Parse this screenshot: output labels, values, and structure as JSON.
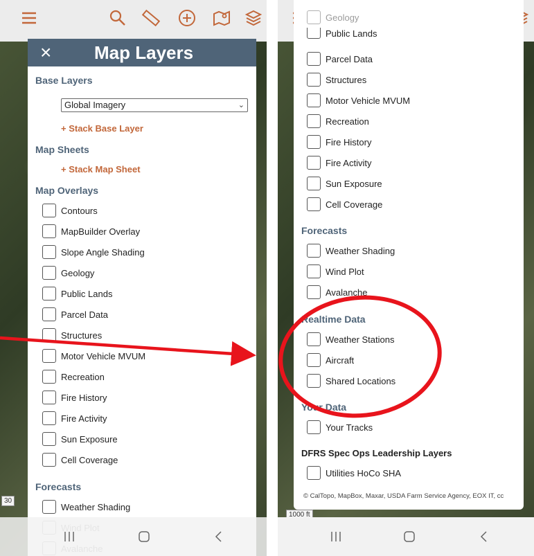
{
  "panel": {
    "title": "Map Layers",
    "close_label": "×"
  },
  "base_layers": {
    "title": "Base Layers",
    "selected": "Global Imagery",
    "stack_link": "+ Stack Base Layer"
  },
  "map_sheets": {
    "title": "Map Sheets",
    "stack_link": "+ Stack Map Sheet"
  },
  "map_overlays": {
    "title": "Map Overlays",
    "items": [
      "Contours",
      "MapBuilder Overlay",
      "Slope Angle Shading",
      "Geology",
      "Public Lands",
      "Parcel Data",
      "Structures",
      "Motor Vehicle MVUM",
      "Recreation",
      "Fire History",
      "Fire Activity",
      "Sun Exposure",
      "Cell Coverage"
    ]
  },
  "forecasts": {
    "title": "Forecasts",
    "items": [
      "Weather Shading",
      "Wind Plot",
      "Avalanche"
    ]
  },
  "realtime": {
    "title": "Realtime Data",
    "items": [
      "Weather Stations",
      "Aircraft",
      "Shared Locations"
    ]
  },
  "your_data": {
    "title": "Your Data",
    "items": [
      "Your Tracks"
    ]
  },
  "dfrs": {
    "title": "DFRS Spec Ops Leadership Layers",
    "items": [
      "Utilities HoCo SHA"
    ]
  },
  "attribution": "© CalTopo, MapBox, Maxar, USDA Farm Service Agency, EOX IT, cc",
  "scale_label": "1000 ft",
  "scale_digits": "30",
  "nav": {
    "recents": "III",
    "home": "○",
    "back": "<"
  },
  "colors": {
    "accent": "#c2673a",
    "header": "#4f6478",
    "annotation": "#e8141c"
  }
}
